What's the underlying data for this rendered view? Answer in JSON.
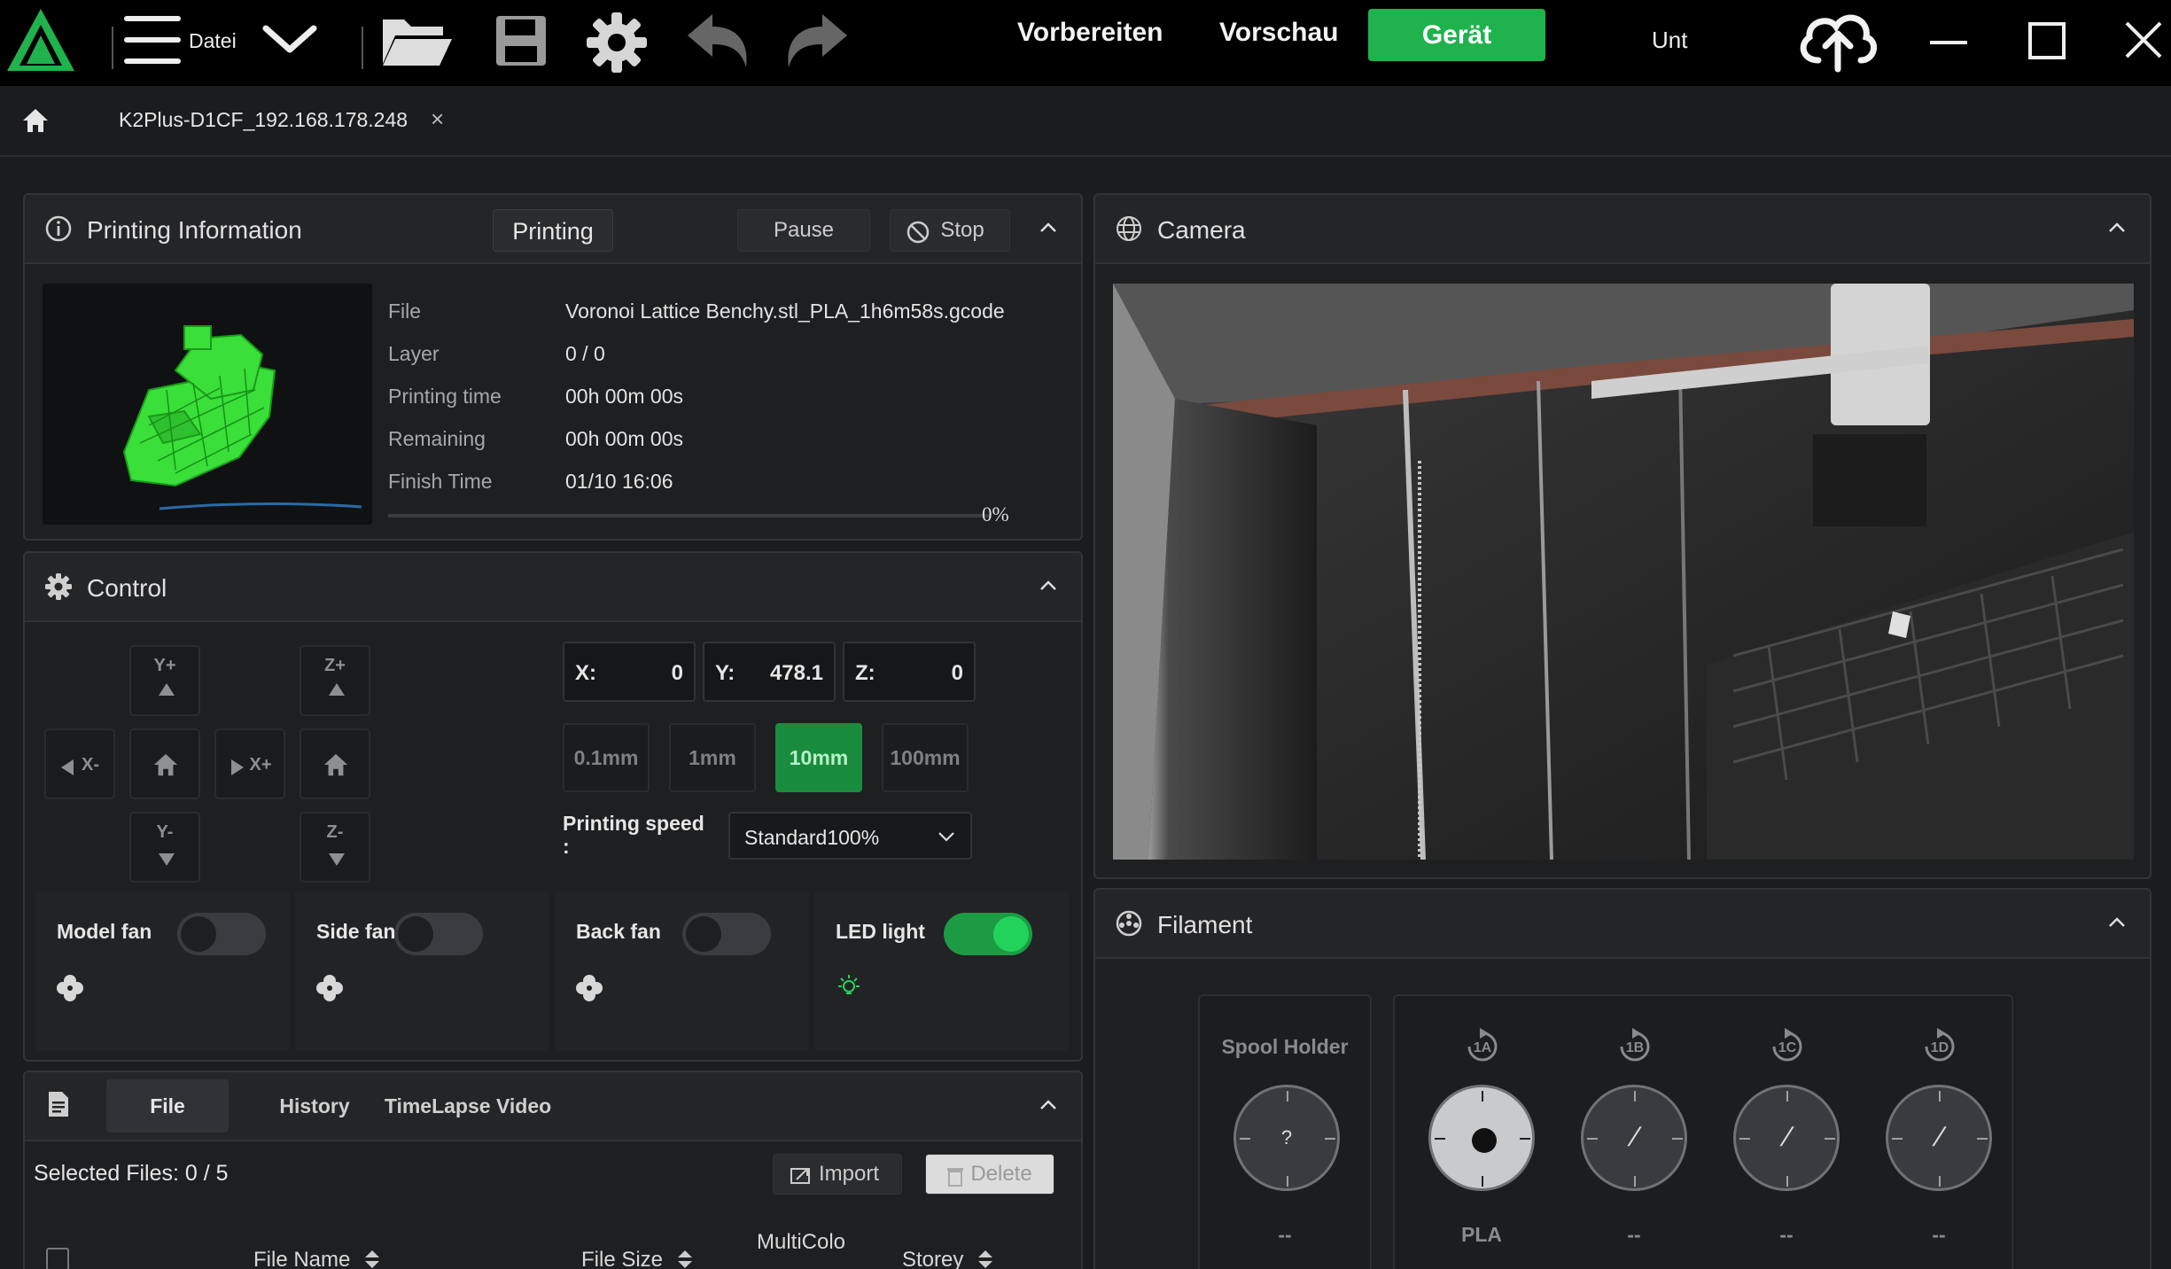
{
  "topbar": {
    "menu_label": "Datei",
    "nav": [
      "Vorbereiten",
      "Vorschau",
      "Gerät"
    ],
    "active_nav": "Gerät",
    "truncated_label": "Unt",
    "accent": "#1fb24d"
  },
  "tab": {
    "device": "K2Plus-D1CF_192.168.178.248",
    "close": "×"
  },
  "printing_info": {
    "title": "Printing Information",
    "status": "Printing",
    "pause": "Pause",
    "stop": "Stop",
    "rows": [
      {
        "label": "File",
        "value": "Voronoi Lattice Benchy.stl_PLA_1h6m58s.gcode"
      },
      {
        "label": "Layer",
        "value": "0 / 0"
      },
      {
        "label": "Printing time",
        "value": "00h 00m 00s"
      },
      {
        "label": "Remaining",
        "value": "00h 00m 00s"
      },
      {
        "label": "Finish Time",
        "value": "01/10 16:06"
      }
    ],
    "progress": 0,
    "progress_text": "0%"
  },
  "control": {
    "title": "Control",
    "jog": {
      "y_plus": "Y+",
      "y_minus": "Y-",
      "x_minus": "X-",
      "x_plus": "X+",
      "z_plus": "Z+",
      "z_minus": "Z-"
    },
    "coords": {
      "x_label": "X:",
      "x": "0",
      "y_label": "Y:",
      "y": "478.1",
      "z_label": "Z:",
      "z": "0"
    },
    "steps": [
      "0.1mm",
      "1mm",
      "10mm",
      "100mm"
    ],
    "active_step": "10mm",
    "speed_label": "Printing speed",
    "speed_colon": ":",
    "speed_value": "Standard100%",
    "fans": [
      {
        "name": "Model fan",
        "on": false
      },
      {
        "name": "Side fan",
        "on": false
      },
      {
        "name": "Back fan",
        "on": false
      },
      {
        "name": "LED light",
        "on": true
      }
    ]
  },
  "files": {
    "tabs": [
      "File",
      "History",
      "TimeLapse Video"
    ],
    "active_tab": "File",
    "selected": "Selected Files: 0 / 5",
    "import": "Import",
    "delete": "Delete",
    "columns": [
      "File Name",
      "File Size",
      "MultiColo",
      "Storey"
    ]
  },
  "camera": {
    "title": "Camera"
  },
  "filament": {
    "title": "Filament",
    "spool_holder": "Spool Holder",
    "spool_holder_mark": "?",
    "spool_holder_value": "--",
    "slots": [
      {
        "id": "1A",
        "material": "PLA",
        "loaded": true
      },
      {
        "id": "1B",
        "material": "--",
        "loaded": false
      },
      {
        "id": "1C",
        "material": "--",
        "loaded": false
      },
      {
        "id": "1D",
        "material": "--",
        "loaded": false
      }
    ]
  }
}
